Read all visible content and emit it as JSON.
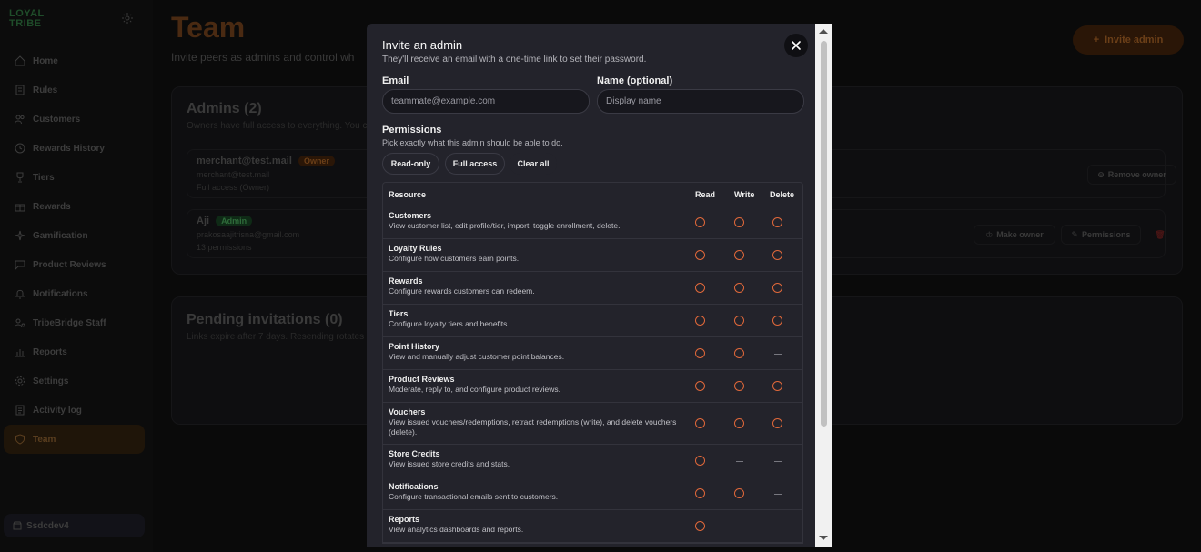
{
  "sidebar": {
    "logo": [
      "LOYAL",
      "TRIBE"
    ],
    "items": [
      {
        "label": "Home",
        "icon": "home-icon"
      },
      {
        "label": "Rules",
        "icon": "document-icon"
      },
      {
        "label": "Customers",
        "icon": "users-icon"
      },
      {
        "label": "Rewards History",
        "icon": "history-icon"
      },
      {
        "label": "Tiers",
        "icon": "trophy-icon"
      },
      {
        "label": "Rewards",
        "icon": "gift-icon"
      },
      {
        "label": "Gamification",
        "icon": "sparkle-icon"
      },
      {
        "label": "Product Reviews",
        "icon": "chat-icon"
      },
      {
        "label": "Notifications",
        "icon": "bell-icon"
      },
      {
        "label": "TribeBridge Staff",
        "icon": "staff-icon"
      },
      {
        "label": "Reports",
        "icon": "chart-icon"
      },
      {
        "label": "Settings",
        "icon": "gear-icon"
      },
      {
        "label": "Activity log",
        "icon": "log-icon"
      },
      {
        "label": "Team",
        "icon": "shield-icon",
        "active": true
      }
    ],
    "workspace": "Ssdcdev4"
  },
  "main": {
    "title": "Team",
    "subtitle": "Invite peers as admins and control wh",
    "invite_button": "Invite admin",
    "admins": {
      "title": "Admins (2)",
      "subtitle": "Owners have full access to everything. You c",
      "rows": [
        {
          "name": "merchant@test.mail",
          "badge": "Owner",
          "email": "merchant@test.mail",
          "meta": "Full access (Owner)"
        },
        {
          "name": "Aji",
          "badge": "Admin",
          "email": "prakosaajitrisna@gmail.com",
          "meta": "13 permissions"
        }
      ],
      "remove_owner": "Remove owner",
      "make_owner": "Make owner",
      "permissions": "Permissions"
    },
    "pending": {
      "title": "Pending invitations (0)",
      "subtitle": "Links expire after 7 days. Resending rotates t"
    }
  },
  "modal": {
    "title": "Invite an admin",
    "subtitle": "They'll receive an email with a one-time link to set their password.",
    "email_label": "Email",
    "email_placeholder": "teammate@example.com",
    "name_label": "Name (optional)",
    "name_placeholder": "Display name",
    "permissions_title": "Permissions",
    "permissions_sub": "Pick exactly what this admin should be able to do.",
    "presets": [
      "Read-only",
      "Full access",
      "Clear all"
    ],
    "table_headers": {
      "resource": "Resource",
      "read": "Read",
      "write": "Write",
      "delete": "Delete"
    },
    "resources": [
      {
        "name": "Customers",
        "desc": "View customer list, edit profile/tier, import, toggle enrollment, delete.",
        "read": true,
        "write": true,
        "delete": true
      },
      {
        "name": "Loyalty Rules",
        "desc": "Configure how customers earn points.",
        "read": true,
        "write": true,
        "delete": true
      },
      {
        "name": "Rewards",
        "desc": "Configure rewards customers can redeem.",
        "read": true,
        "write": true,
        "delete": true
      },
      {
        "name": "Tiers",
        "desc": "Configure loyalty tiers and benefits.",
        "read": true,
        "write": true,
        "delete": true
      },
      {
        "name": "Point History",
        "desc": "View and manually adjust customer point balances.",
        "read": true,
        "write": true,
        "delete": false
      },
      {
        "name": "Product Reviews",
        "desc": "Moderate, reply to, and configure product reviews.",
        "read": true,
        "write": true,
        "delete": true
      },
      {
        "name": "Vouchers",
        "desc": "View issued vouchers/redemptions, retract redemptions (write), and delete vouchers (delete).",
        "read": true,
        "write": true,
        "delete": true
      },
      {
        "name": "Store Credits",
        "desc": "View issued store credits and stats.",
        "read": true,
        "write": false,
        "delete": false
      },
      {
        "name": "Notifications",
        "desc": "Configure transactional emails sent to customers.",
        "read": true,
        "write": true,
        "delete": false
      },
      {
        "name": "Reports",
        "desc": "View analytics dashboards and reports.",
        "read": true,
        "write": false,
        "delete": false
      }
    ]
  },
  "colors": {
    "accent": "#e0683a",
    "modal_bg": "#23232b",
    "page_bg": "#0a0a0a"
  }
}
